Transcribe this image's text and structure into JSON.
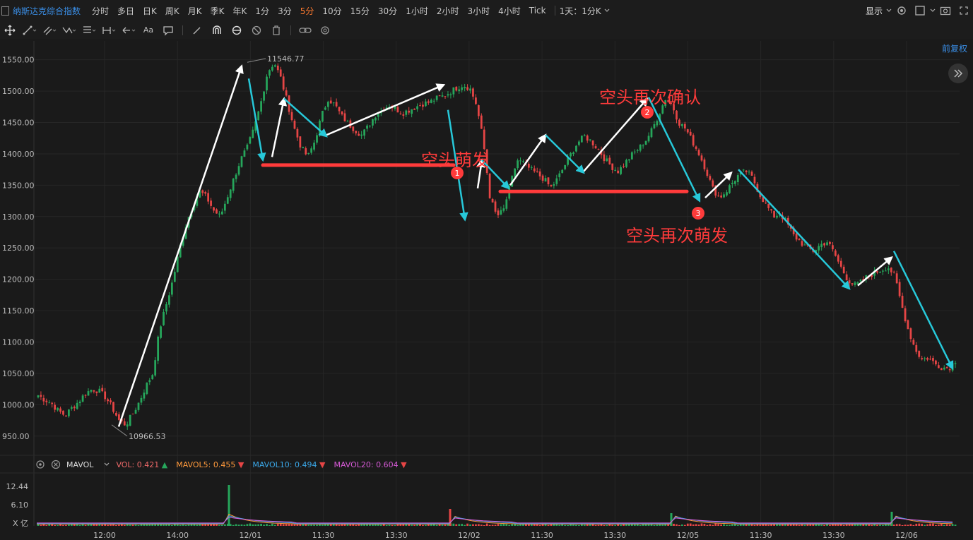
{
  "toolbar": {
    "symbol": "纳斯达克综合指数",
    "timeframes": [
      "分时",
      "多日",
      "日K",
      "周K",
      "月K",
      "季K",
      "年K",
      "1分",
      "3分",
      "5分",
      "10分",
      "15分",
      "30分",
      "1小时",
      "2小时",
      "3小时",
      "4小时",
      "Tick"
    ],
    "active_timeframe": "5分",
    "period_select": "1天：1分K",
    "display_label": "显示"
  },
  "drawbar": {
    "text_tool": "Aa"
  },
  "fuquan_label": "前复权",
  "axis": {
    "price_ticks": [
      "1550.00",
      "1500.00",
      "1450.00",
      "1400.00",
      "1350.00",
      "1300.00",
      "1250.00",
      "1200.00",
      "1150.00",
      "1100.00",
      "1050.00",
      "1000.00",
      "950.00"
    ],
    "time_ticks": [
      "12:00",
      "14:00",
      "12/01",
      "11:30",
      "13:30",
      "12/02",
      "11:30",
      "13:30",
      "12/05",
      "11:30",
      "13:30",
      "12/06"
    ],
    "vol_ticks": [
      "12.44",
      "6.10",
      "X 亿"
    ]
  },
  "chart_labels": {
    "high": "11546.77",
    "low": "10966.53",
    "annot1": "空头萌发",
    "annot2": "空头再次确认",
    "annot3": "空头再次萌发",
    "badge1": "1",
    "badge2": "2",
    "badge3": "3"
  },
  "volume_indicators": {
    "name": "MAVOL",
    "vol_label": "VOL:",
    "vol_value": "0.421",
    "mavol5_label": "MAVOL5:",
    "mavol5_value": "0.455",
    "mavol10_label": "MAVOL10:",
    "mavol10_value": "0.494",
    "mavol20_label": "MAVOL20:",
    "mavol20_value": "0.604"
  },
  "colors": {
    "up": "#26a65b",
    "down": "#e64545",
    "accent": "#3a8ee6",
    "active": "#ff7a2f",
    "annotation": "#ff3b3b",
    "cyan": "#27c8d9"
  },
  "chart_data": {
    "type": "candlestick",
    "ylim": [
      925,
      1580
    ],
    "ylabel": "",
    "xlabel": "",
    "path_close": [
      1015,
      1008,
      1002,
      990,
      983,
      995,
      1005,
      1018,
      1025,
      1022,
      1012,
      995,
      975,
      968,
      985,
      1005,
      1030,
      1050,
      1120,
      1160,
      1200,
      1250,
      1290,
      1320,
      1340,
      1330,
      1310,
      1300,
      1330,
      1360,
      1390,
      1410,
      1440,
      1480,
      1530,
      1546,
      1520,
      1480,
      1440,
      1410,
      1395,
      1420,
      1460,
      1488,
      1478,
      1460,
      1448,
      1438,
      1430,
      1445,
      1462,
      1470,
      1478,
      1472,
      1465,
      1470,
      1475,
      1480,
      1482,
      1488,
      1492,
      1498,
      1505,
      1510,
      1505,
      1478,
      1420,
      1330,
      1300,
      1310,
      1350,
      1390,
      1385,
      1375,
      1368,
      1360,
      1346,
      1360,
      1380,
      1400,
      1418,
      1428,
      1420,
      1408,
      1392,
      1380,
      1372,
      1385,
      1398,
      1408,
      1420,
      1438,
      1462,
      1488,
      1478,
      1450,
      1440,
      1420,
      1400,
      1375,
      1345,
      1330,
      1340,
      1355,
      1368,
      1372,
      1360,
      1335,
      1318,
      1300,
      1305,
      1290,
      1270,
      1260,
      1250,
      1245,
      1255,
      1260,
      1242,
      1220,
      1200,
      1190,
      1195,
      1205,
      1210,
      1215,
      1220,
      1205,
      1160,
      1120,
      1090,
      1072,
      1075,
      1065,
      1060,
      1058,
      1070
    ]
  }
}
